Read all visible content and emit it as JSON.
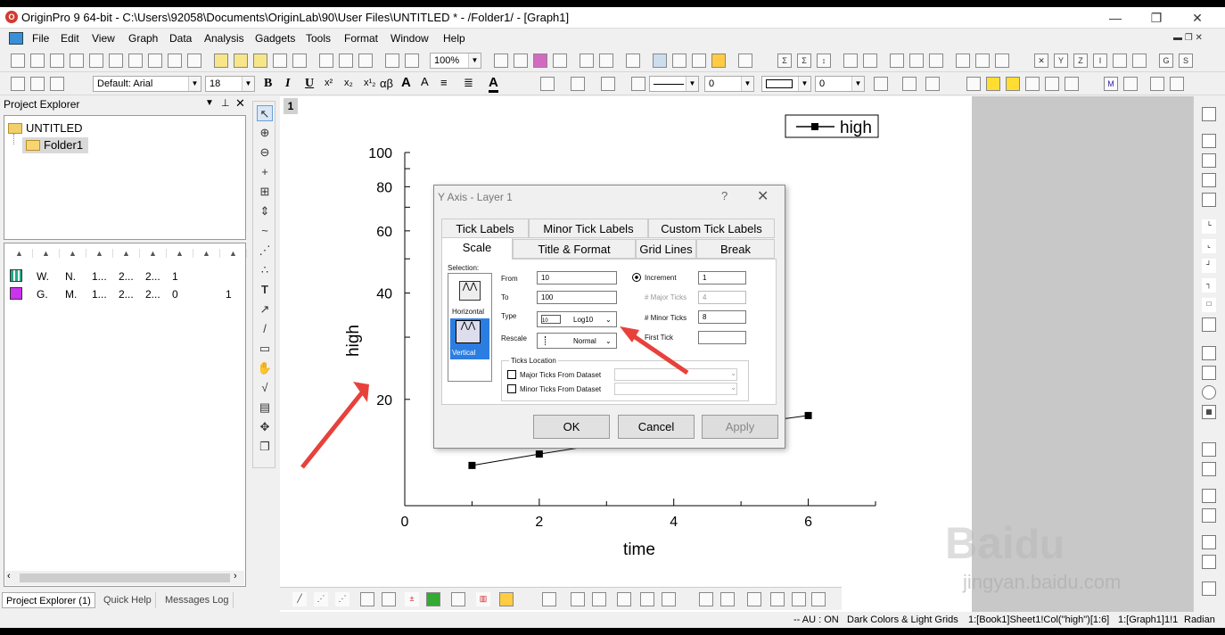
{
  "window": {
    "title": "OriginPro 9 64-bit - C:\\Users\\92058\\Documents\\OriginLab\\90\\User Files\\UNTITLED * - /Folder1/ - [Graph1]",
    "minimize": "—",
    "restore": "❐",
    "close": "✕"
  },
  "menu": [
    "File",
    "Edit",
    "View",
    "Graph",
    "Data",
    "Analysis",
    "Gadgets",
    "Tools",
    "Format",
    "Window",
    "Help"
  ],
  "toolbar": {
    "zoom": "100%",
    "font": "Default: Arial",
    "font_size": "18",
    "bold": "B",
    "italic": "I",
    "underline": "U",
    "greek": "αβ",
    "line_width_a": "0",
    "line_width_b": "0"
  },
  "project_explorer": {
    "title": "Project Explorer",
    "root": "UNTITLED",
    "folder": "Folder1",
    "rows": [
      [
        "W.",
        "N.",
        "1...",
        "2...",
        "2...",
        "1",
        ""
      ],
      [
        "G.",
        "M.",
        "1...",
        "2...",
        "2...",
        "0",
        "1"
      ]
    ]
  },
  "bottom_tabs": [
    "Project Explorer (1)",
    "Quick Help",
    "Messages Log"
  ],
  "graph": {
    "layer": "1",
    "legend": "high",
    "xlabel": "time",
    "ylabel": "high",
    "xticks": [
      "0",
      "2",
      "4",
      "6"
    ],
    "yticks": [
      "100",
      "80",
      "60",
      "40",
      "20"
    ]
  },
  "chart_data": {
    "type": "line",
    "x": [
      1,
      2,
      3,
      4,
      5,
      6
    ],
    "y": [
      13,
      14,
      15,
      16,
      17,
      18
    ],
    "xlabel": "time",
    "ylabel": "high",
    "xlim": [
      0,
      7
    ],
    "ylim": [
      10,
      100
    ],
    "yscale": "log10",
    "series": [
      {
        "name": "high",
        "values": [
          13,
          14,
          15,
          16,
          17,
          18
        ]
      }
    ],
    "legend_position": "top-right"
  },
  "dialog": {
    "title": "Y Axis - Layer 1",
    "help": "?",
    "close": "✕",
    "tabs_back": [
      "Tick Labels",
      "Minor Tick Labels",
      "Custom Tick Labels"
    ],
    "tabs_front": [
      "Scale",
      "Title & Format",
      "Grid Lines",
      "Break"
    ],
    "selection_label": "Selection:",
    "horizontal": "Horizontal",
    "vertical": "Vertical",
    "from_label": "From",
    "from_value": "10",
    "to_label": "To",
    "to_value": "100",
    "type_label": "Type",
    "type_value": "Log10",
    "rescale_label": "Rescale",
    "rescale_value": "Normal",
    "increment_label": "Increment",
    "increment_value": "1",
    "major_ticks_label": "# Major Ticks",
    "major_ticks_value": "4",
    "minor_ticks_label": "# Minor Ticks",
    "minor_ticks_value": "8",
    "first_tick_label": "First Tick",
    "first_tick_value": "",
    "ticks_location": "Ticks Location",
    "major_from_dataset": "Major Ticks From Dataset",
    "minor_from_dataset": "Minor Ticks From Dataset",
    "ok": "OK",
    "cancel": "Cancel",
    "apply": "Apply"
  },
  "status": {
    "au": "-- AU : ON",
    "theme": "Dark Colors & Light Grids",
    "col": "1:[Book1]Sheet1!Col(\"high\")[1:6]",
    "graph": "1:[Graph1]1!1",
    "angle": "Radian"
  },
  "watermark": "jingyan.baidu.com",
  "annotation_color": "#e8413b"
}
